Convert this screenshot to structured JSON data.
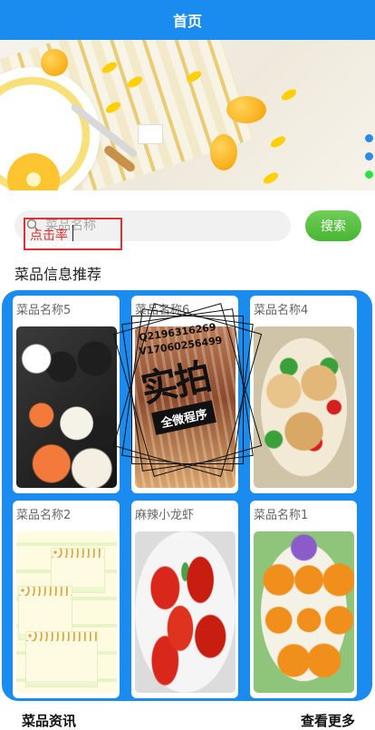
{
  "header": {
    "title": "首页"
  },
  "carousel": {
    "slide_count": 3,
    "active_index": 2,
    "accent_color": "#2b8ae8",
    "active_color": "#2ee048"
  },
  "search": {
    "placeholder": "菜品名称",
    "overlay_text": "点击率",
    "button_label": "搜索"
  },
  "recommend": {
    "title": "菜品信息推荐",
    "items": [
      {
        "name": "菜品名称5"
      },
      {
        "name": "菜品名称6"
      },
      {
        "name": "菜品名称4"
      },
      {
        "name": "菜品名称2"
      },
      {
        "name": "麻辣小龙虾"
      },
      {
        "name": "菜品名称1"
      }
    ]
  },
  "watermark": {
    "line1": "Q2196316269",
    "line2": "V17060256499",
    "big": "实拍",
    "ribbon": "全微程序"
  },
  "news": {
    "title": "菜品资讯",
    "more_label": "查看更多"
  },
  "colors": {
    "primary": "#1a8cf0",
    "search_button": "#55bb3d",
    "highlight": "#e03030"
  }
}
